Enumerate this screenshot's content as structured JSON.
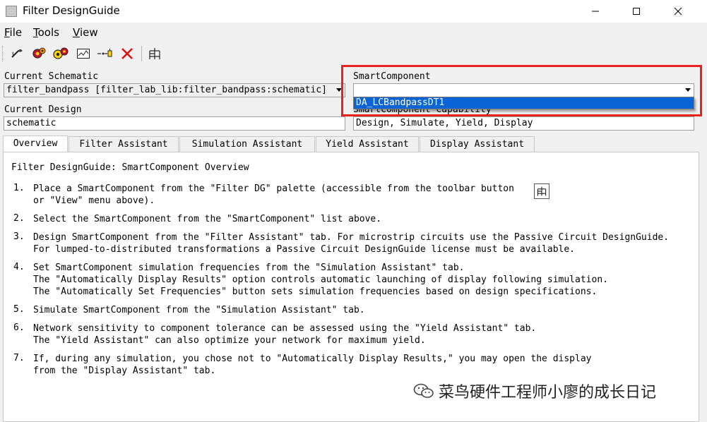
{
  "window": {
    "title": "Filter DesignGuide",
    "minimize_icon": "minimize-icon",
    "maximize_icon": "maximize-icon",
    "close_icon": "close-icon"
  },
  "menu": {
    "items": [
      {
        "label": "File"
      },
      {
        "label": "Tools"
      },
      {
        "label": "View"
      }
    ]
  },
  "toolbar": {
    "icons": [
      "wand-icon",
      "gear-icon",
      "gears-icon",
      "graph-icon",
      "component-icon",
      "delete-icon",
      "palette-icon"
    ]
  },
  "schematic": {
    "label": "Current Schematic",
    "value": "filter_bandpass [filter_lab_lib:filter_bandpass:schematic]"
  },
  "design": {
    "label": "Current Design",
    "value": "schematic"
  },
  "smart_component": {
    "label": "SmartComponent",
    "value": "",
    "option": "DA_LCBandpassDT1"
  },
  "capability": {
    "label": "SmartComponent Capability",
    "value": "Design, Simulate, Yield, Display"
  },
  "tabs": [
    {
      "label": "Overview"
    },
    {
      "label": "Filter Assistant"
    },
    {
      "label": "Simulation Assistant"
    },
    {
      "label": "Yield Assistant"
    },
    {
      "label": "Display Assistant"
    }
  ],
  "content": {
    "heading": "Filter DesignGuide: SmartComponent Overview",
    "steps": [
      {
        "num": "1.",
        "lines": [
          "Place a SmartComponent from the \"Filter DG\" palette (accessible from the toolbar button",
          "or \"View\" menu above)."
        ]
      },
      {
        "num": "2.",
        "lines": [
          "Select the SmartComponent from the \"SmartComponent\" list above."
        ]
      },
      {
        "num": "3.",
        "lines": [
          "Design SmartComponent from the \"Filter Assistant\" tab. For microstrip circuits use the Passive Circuit DesignGuide.",
          "For lumped-to-distributed transformations a Passive Circuit DesignGuide license must be available."
        ]
      },
      {
        "num": "4.",
        "lines": [
          "Set SmartComponent simulation frequencies from the \"Simulation Assistant\" tab.",
          "The \"Automatically Display Results\" option controls automatic launching of display following simulation.",
          "The \"Automatically Set Frequencies\" button sets simulation frequencies based on design specifications."
        ]
      },
      {
        "num": "5.",
        "lines": [
          "Simulate SmartComponent from the \"Simulation Assistant\" tab."
        ]
      },
      {
        "num": "6.",
        "lines": [
          "Network sensitivity to component tolerance can be assessed using the \"Yield Assistant\" tab.",
          "The \"Yield Assistant\" can also optimize your network for maximum yield."
        ]
      },
      {
        "num": "7.",
        "lines": [
          "If, during any simulation, you chose not to \"Automatically Display Results,\" you may open the display",
          "from the \"Display Assistant\" tab."
        ]
      }
    ]
  },
  "watermark": {
    "text": "菜鸟硬件工程师小廖的成长日记",
    "icon": "wechat-icon"
  },
  "colors": {
    "highlight": "#e8201e",
    "selection": "#0a64d6"
  }
}
